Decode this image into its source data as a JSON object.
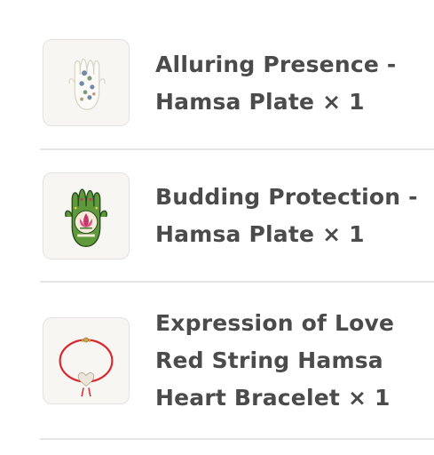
{
  "cart": {
    "items": [
      {
        "title": "Alluring Presence - Hamsa Plate × 1",
        "thumbnail_icon": "white-hamsa-plate-image"
      },
      {
        "title": "Budding Protection - Hamsa Plate × 1",
        "thumbnail_icon": "green-hamsa-plate-image"
      },
      {
        "title": "Expression of Love Red String Hamsa Heart Bracelet × 1",
        "thumbnail_icon": "red-string-bracelet-image"
      }
    ]
  },
  "colors": {
    "text": "#4b4b4b",
    "divider": "#e6e6e6",
    "thumb_border": "#e4e2de",
    "thumb_bg": "#f8f6f2"
  }
}
